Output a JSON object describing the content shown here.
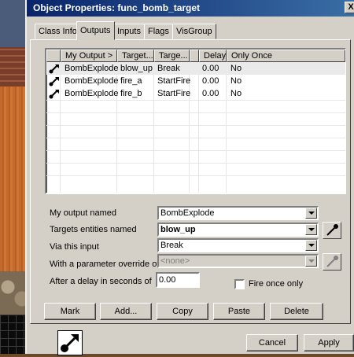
{
  "window": {
    "title": "Object Properties: func_bomb_target",
    "close_label": "X"
  },
  "tabs": [
    {
      "label": "Class Info",
      "active": false
    },
    {
      "label": "Outputs",
      "active": true
    },
    {
      "label": "Inputs",
      "active": false
    },
    {
      "label": "Flags",
      "active": false
    },
    {
      "label": "VisGroup",
      "active": false
    }
  ],
  "outputs_table": {
    "columns": [
      "My Output >",
      "Target...",
      "Targe...",
      "Delay",
      "Only Once"
    ],
    "rows": [
      {
        "output": "BombExplode",
        "target": "blow_up",
        "input": "Break",
        "delay": "0.00",
        "once": "No",
        "icon": "output-arrow-icon"
      },
      {
        "output": "BombExplode",
        "target": "fire_a",
        "input": "StartFire",
        "delay": "0.00",
        "once": "No",
        "icon": "output-arrow-icon"
      },
      {
        "output": "BombExplode",
        "target": "fire_b",
        "input": "StartFire",
        "delay": "0.00",
        "once": "No",
        "icon": "output-arrow-icon"
      }
    ]
  },
  "form": {
    "output_label": "My output named",
    "output_value": "BombExplode",
    "targets_label": "Targets entities named",
    "targets_value": "blow_up",
    "input_label": "Via this input",
    "input_value": "Break",
    "param_label": "With a parameter override of",
    "param_value": "<none>",
    "delay_label": "After a delay in seconds of",
    "delay_value": "0.00",
    "fire_once_label": "Fire once only",
    "fire_once_checked": false
  },
  "buttons": {
    "mark": "Mark",
    "add": "Add...",
    "copy": "Copy",
    "paste": "Paste",
    "delete": "Delete",
    "cancel": "Cancel",
    "apply": "Apply"
  },
  "icons": {
    "eyedropper": "eyedropper-icon",
    "entity": "output-arrow-icon"
  }
}
